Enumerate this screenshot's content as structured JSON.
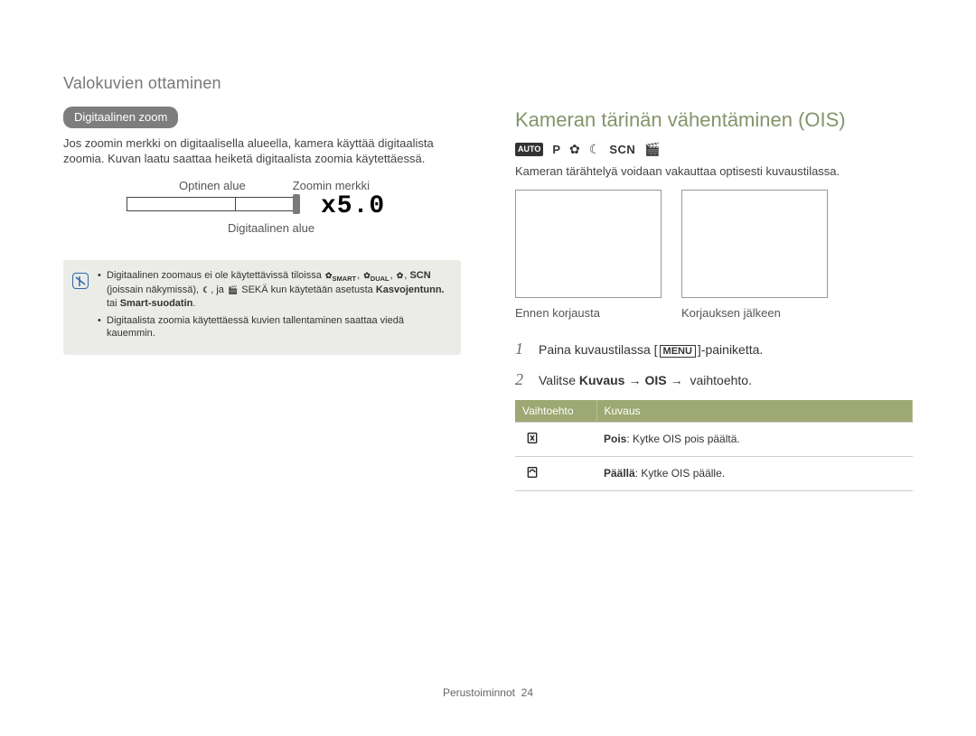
{
  "page_title": "Valokuvien ottaminen",
  "left": {
    "pill": "Digitaalinen zoom",
    "body": "Jos zoomin merkki on digitaalisella alueella, kamera käyttää digitaalista zoomia. Kuvan laatu saattaa heiketä digitaalista zoomia käytettäessä.",
    "label_optical": "Optinen alue",
    "label_marker": "Zoomin merkki",
    "zoom_value": "x5.0",
    "label_digital": "Digitaalinen alue",
    "note_bullet1_prefix": "Digitaalinen zoomaus ei ole käytettävissä tiloissa ",
    "note_bullet1_scn": "SCN",
    "note_bullet1_mid": " (joissain näkymissä), ",
    "note_bullet1_suffix": " SEKÄ kun käytetään asetusta ",
    "note_bullet1_strong1": "Kasvojentunn.",
    "note_bullet1_or": " tai ",
    "note_bullet1_strong2": "Smart-suodatin",
    "note_bullet1_period": ".",
    "note_bullet2": "Digitaalista zoomia käytettäessä kuvien tallentaminen saattaa viedä kauemmin."
  },
  "right": {
    "heading": "Kameran tärinän vähentäminen (OIS)",
    "modes": {
      "auto": "AUTO",
      "p": "P",
      "scn": "SCN"
    },
    "intro": "Kameran tärähtelyä voidaan vakauttaa optisesti kuvaustilassa.",
    "caption_before": "Ennen korjausta",
    "caption_after": "Korjauksen jälkeen",
    "steps": {
      "s1_pre": "Paina kuvaustilassa [",
      "s1_menu": "MENU",
      "s1_post": "]-painiketta.",
      "s2_pre": "Valitse ",
      "s2_b1": "Kuvaus",
      "s2_b2": "OIS",
      "s2_post": " vaihtoehto."
    },
    "table": {
      "h1": "Vaihtoehto",
      "h2": "Kuvaus",
      "r1_desc_strong": "Pois",
      "r1_desc_rest": ": Kytke OIS pois päältä.",
      "r2_desc_strong": "Päällä",
      "r2_desc_rest": ": Kytke OIS päälle."
    }
  },
  "footer": {
    "section": "Perustoiminnot",
    "page": "24"
  }
}
